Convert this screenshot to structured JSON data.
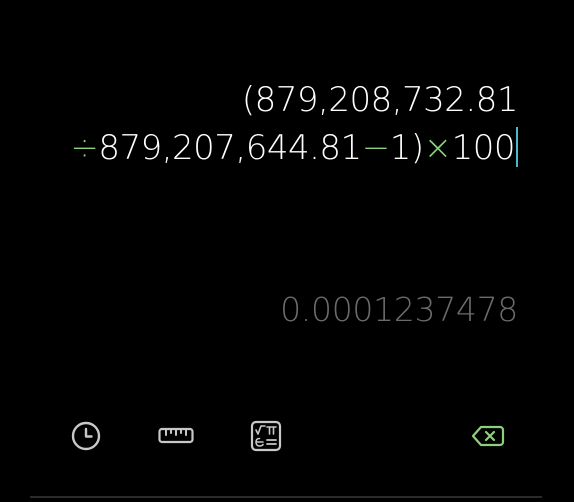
{
  "display": {
    "expression": {
      "line1": "(879,208,732.81",
      "line2_divide_op": "÷",
      "line2_num": "879,207,644.81",
      "line2_minus_op": "−",
      "line2_one_close": "1)",
      "line2_times_op": "×",
      "line2_hundred": "100"
    },
    "result": "0.0001237478"
  },
  "toolbar": {
    "icons": [
      "history-icon",
      "ruler-icon",
      "scientific-icon",
      "backspace-icon"
    ]
  },
  "colors": {
    "background": "#000000",
    "expression_text": "#ffffff",
    "operator": "#8fd07f",
    "result_text": "#6b6b6b",
    "cursor": "#4fb8c8",
    "icon": "#c8c8c8",
    "backspace_icon": "#8fd07f"
  }
}
